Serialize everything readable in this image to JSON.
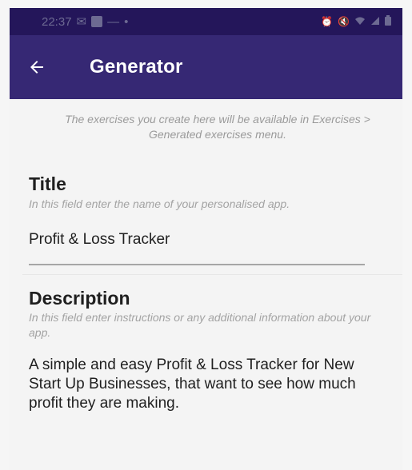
{
  "status_bar": {
    "time": "22:37",
    "left_icons": [
      "mail-icon",
      "linkedin-icon",
      "dash-icon",
      "dot-icon"
    ],
    "right_icons": [
      "alarm-icon",
      "mute-icon",
      "wifi-icon",
      "signal-icon",
      "battery-icon"
    ]
  },
  "app_bar": {
    "title": "Generator",
    "back_icon": "arrow-left-icon"
  },
  "info": {
    "text": "The exercises you create here will be available in Exercises > Generated exercises menu."
  },
  "title_field": {
    "heading": "Title",
    "hint": "In this field enter the name of your personalised app.",
    "value": "Profit & Loss Tracker"
  },
  "description_field": {
    "heading": "Description",
    "hint": "In this field enter instructions or any additional information about your app.",
    "value": "A simple and easy Profit & Loss Tracker for New Start Up Businesses, that want to see how much profit they are making."
  },
  "colors": {
    "status_bar": "#24165a",
    "app_bar": "#362874",
    "background": "#f4f4f4"
  }
}
